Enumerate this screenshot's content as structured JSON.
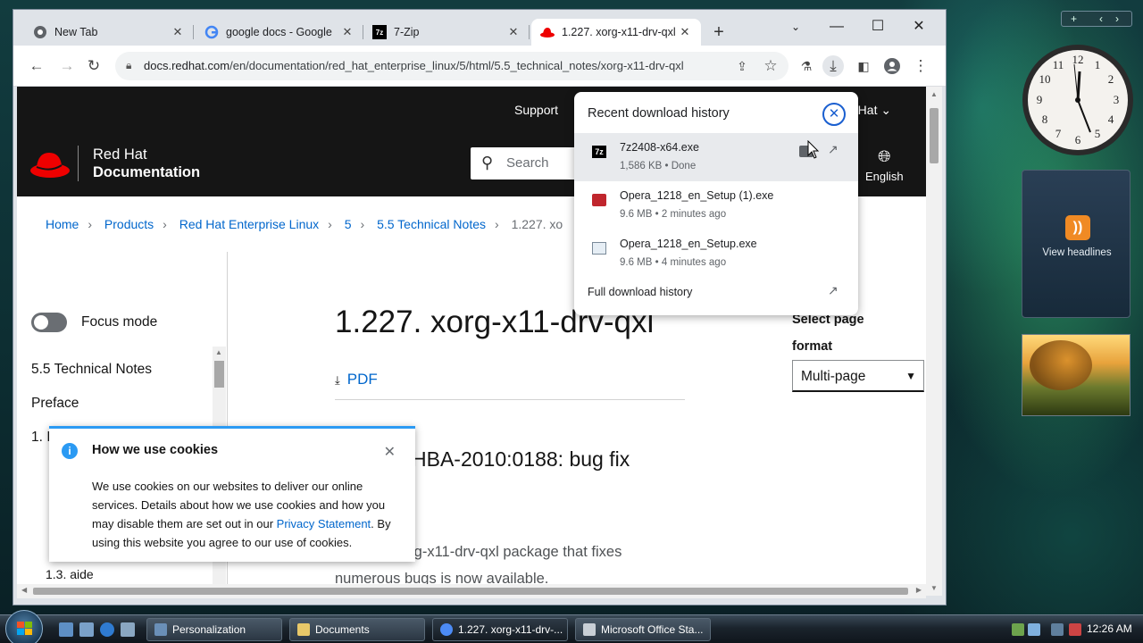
{
  "browser": {
    "tabs": [
      {
        "label": "New Tab",
        "icon": "chrome-icon"
      },
      {
        "label": "google docs - Google",
        "icon": "google-icon"
      },
      {
        "label": "7-Zip",
        "icon": "7zip-icon"
      },
      {
        "label": "1.227. xorg-x11-drv-qxl",
        "icon": "redhat-icon",
        "active": true
      }
    ],
    "new_tab": "+",
    "url_host": "docs.redhat.com",
    "url_path": "/en/documentation/red_hat_enterprise_linux/5/html/5.5_technical_notes/xorg-x11-drv-qxl"
  },
  "header": {
    "brand_line1": "Red Hat",
    "brand_line2": "Documentation",
    "support": "Support",
    "search_placeholder": "Search",
    "redhat_menu": "d Hat",
    "language": "English",
    "brand_color": "#ee0000"
  },
  "breadcrumb": [
    "Home",
    "Products",
    "Red Hat Enterprise Linux",
    "5",
    "5.5 Technical Notes",
    "1.227. xo"
  ],
  "sidebar": {
    "focus_mode": "Focus mode",
    "toc": [
      "5.5 Technical Notes",
      "Preface",
      "1. I",
      "1.3. aide"
    ]
  },
  "article": {
    "title": "1.227. xorg-x11-drv-qxl",
    "pdf": "PDF",
    "advisory": "HBA-2010:0188: bug fix",
    "para_line1": "d xorg-x11-drv-qxl package that fixes",
    "para_line2": "numerous bugs is now available."
  },
  "format": {
    "label_line1": "Select page",
    "label_line2": "format",
    "selected": "Multi-page"
  },
  "cookie": {
    "title": "How we use cookies",
    "body_before": "We use cookies on our websites to deliver our online services. Details about how we use cookies and how you may disable them are set out in our ",
    "link": "Privacy Statement",
    "body_after": ". By using this website you agree to our use of cookies."
  },
  "downloads": {
    "title": "Recent download history",
    "items": [
      {
        "name": "7z2408-x64.exe",
        "status": "1,586 KB • Done",
        "icon": "7zip-icon"
      },
      {
        "name": "Opera_1218_en_Setup (1).exe",
        "status": "9.6 MB • 2 minutes ago",
        "icon": "opera-installer-icon"
      },
      {
        "name": "Opera_1218_en_Setup.exe",
        "status": "9.6 MB • 4 minutes ago",
        "icon": "generic-exe-icon"
      }
    ],
    "full_history": "Full download history"
  },
  "gadgets": {
    "feed_label": "View headlines"
  },
  "taskbar": {
    "tasks": [
      "Personalization",
      "Documents",
      "1.227. xorg-x11-drv-...",
      "Microsoft Office Sta..."
    ],
    "time": "12:26 AM"
  }
}
